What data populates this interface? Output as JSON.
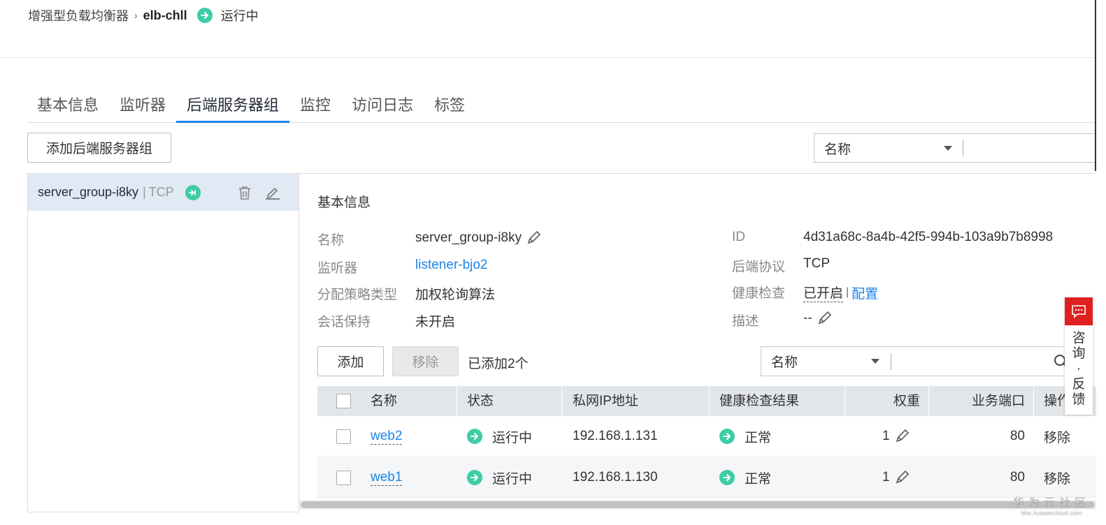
{
  "breadcrumb": {
    "root": "增强型负载均衡器",
    "current": "elb-chll",
    "status": "运行中"
  },
  "tabs": [
    {
      "label": "基本信息"
    },
    {
      "label": "监听器"
    },
    {
      "label": "后端服务器组",
      "active": true
    },
    {
      "label": "监控"
    },
    {
      "label": "访问日志"
    },
    {
      "label": "标签"
    }
  ],
  "toolbar": {
    "add_group_label": "添加后端服务器组",
    "filter_select": "名称",
    "filter_value": ""
  },
  "group_list": {
    "items": [
      {
        "name": "server_group-i8ky",
        "sep": "|",
        "protocol": "TCP"
      }
    ]
  },
  "detail": {
    "section_title": "基本信息",
    "name_label": "名称",
    "name_value": "server_group-i8ky",
    "listener_label": "监听器",
    "listener_value": "listener-bjo2",
    "policy_label": "分配策略类型",
    "policy_value": "加权轮询算法",
    "session_label": "会话保持",
    "session_value": "未开启",
    "id_label": "ID",
    "id_value": "4d31a68c-8a4b-42f5-994b-103a9b7b8998",
    "protocol_label": "后端协议",
    "protocol_value": "TCP",
    "health_label": "健康检查",
    "health_value": "已开启",
    "health_sep": "|",
    "health_config": "配置",
    "desc_label": "描述",
    "desc_value": "--"
  },
  "members": {
    "add_label": "添加",
    "remove_label": "移除",
    "count_text": "已添加2个",
    "filter_select": "名称",
    "filter_value": "",
    "columns": [
      "名称",
      "状态",
      "私网IP地址",
      "健康检查结果",
      "权重",
      "业务端口",
      "操作"
    ],
    "rows": [
      {
        "name": "web2",
        "status": "运行中",
        "ip": "192.168.1.131",
        "health": "正常",
        "weight": "1",
        "port": "80",
        "action": "移除"
      },
      {
        "name": "web1",
        "status": "运行中",
        "ip": "192.168.1.130",
        "health": "正常",
        "weight": "1",
        "port": "80",
        "action": "移除"
      }
    ]
  },
  "feedback": {
    "label_lines": [
      "咨",
      "询",
      "·",
      "反",
      "馈"
    ]
  },
  "watermark": {
    "brand": "华为云社区",
    "url": "bbs.huaweicloud.com"
  },
  "colors": {
    "accent": "#1a85e8",
    "ok": "#3dcca6",
    "feedback": "#e02020"
  }
}
